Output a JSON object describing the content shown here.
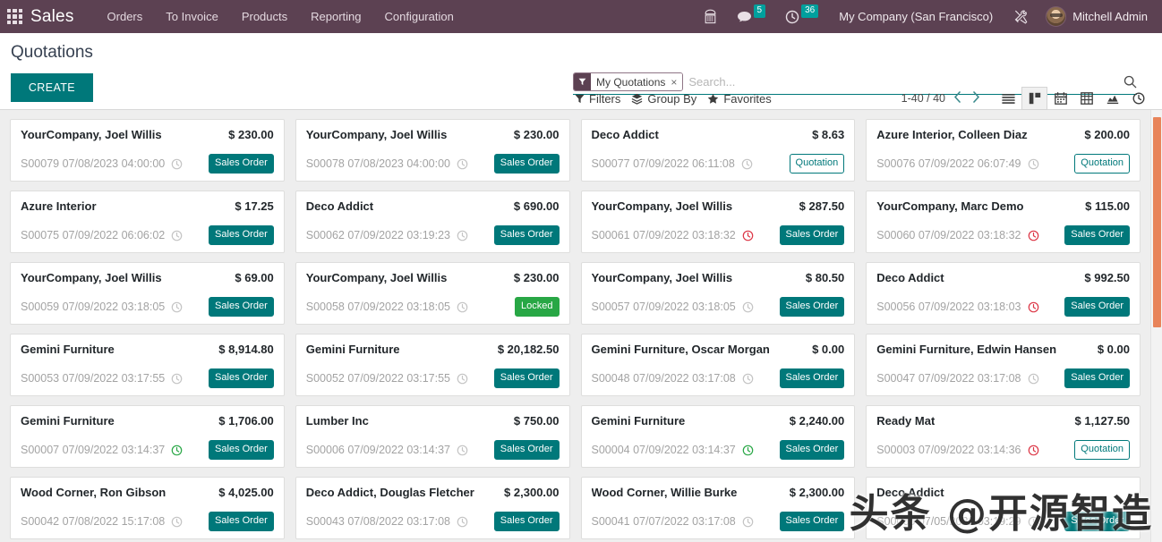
{
  "navbar": {
    "apps_icon": "apps-grid-icon",
    "brand": "Sales",
    "menu": [
      {
        "label": "Orders"
      },
      {
        "label": "To Invoice"
      },
      {
        "label": "Products"
      },
      {
        "label": "Reporting"
      },
      {
        "label": "Configuration"
      }
    ],
    "right": {
      "phone_icon": "dialpad-icon",
      "messages_icon": "chat-icon",
      "messages_count": "5",
      "activities_icon": "clock-icon",
      "activities_count": "36",
      "company": "My Company (San Francisco)",
      "tools_icon": "wrench-screwdriver-icon",
      "avatar_icon": "user-avatar",
      "user": "Mitchell Admin"
    }
  },
  "control_panel": {
    "title": "Quotations",
    "create_label": "CREATE",
    "search": {
      "facet_icon": "filter-funnel-icon",
      "facet_label": "My Quotations",
      "facet_remove": "×",
      "placeholder": "Search...",
      "value": "",
      "search_icon": "search-icon"
    },
    "filters_label": "Filters",
    "groupby_label": "Group By",
    "favorites_label": "Favorites",
    "pager": "1-40 / 40",
    "views": [
      {
        "name": "list",
        "active": false
      },
      {
        "name": "kanban",
        "active": true
      },
      {
        "name": "calendar",
        "active": false
      },
      {
        "name": "pivot",
        "active": false
      },
      {
        "name": "graph",
        "active": false
      },
      {
        "name": "activity",
        "active": false
      }
    ]
  },
  "kanban": {
    "cards": [
      {
        "customer": "YourCompany, Joel Willis",
        "amount": "$ 230.00",
        "ref": "S00079 07/08/2023 04:00:00",
        "activity": "none",
        "status": "Sales Order",
        "status_type": "sales-order"
      },
      {
        "customer": "YourCompany, Joel Willis",
        "amount": "$ 230.00",
        "ref": "S00078 07/08/2023 04:00:00",
        "activity": "none",
        "status": "Sales Order",
        "status_type": "sales-order"
      },
      {
        "customer": "Deco Addict",
        "amount": "$ 8.63",
        "ref": "S00077 07/09/2022 06:11:08",
        "activity": "none",
        "status": "Quotation",
        "status_type": "quotation"
      },
      {
        "customer": "Azure Interior, Colleen Diaz",
        "amount": "$ 200.00",
        "ref": "S00076 07/09/2022 06:07:49",
        "activity": "none",
        "status": "Quotation",
        "status_type": "quotation"
      },
      {
        "customer": "Azure Interior",
        "amount": "$ 17.25",
        "ref": "S00075 07/09/2022 06:06:02",
        "activity": "none",
        "status": "Sales Order",
        "status_type": "sales-order"
      },
      {
        "customer": "Deco Addict",
        "amount": "$ 690.00",
        "ref": "S00062 07/09/2022 03:19:23",
        "activity": "none",
        "status": "Sales Order",
        "status_type": "sales-order"
      },
      {
        "customer": "YourCompany, Joel Willis",
        "amount": "$ 287.50",
        "ref": "S00061 07/09/2022 03:18:32",
        "activity": "late",
        "status": "Sales Order",
        "status_type": "sales-order"
      },
      {
        "customer": "YourCompany, Marc Demo",
        "amount": "$ 115.00",
        "ref": "S00060 07/09/2022 03:18:32",
        "activity": "late",
        "status": "Sales Order",
        "status_type": "sales-order"
      },
      {
        "customer": "YourCompany, Joel Willis",
        "amount": "$ 69.00",
        "ref": "S00059 07/09/2022 03:18:05",
        "activity": "none",
        "status": "Sales Order",
        "status_type": "sales-order"
      },
      {
        "customer": "YourCompany, Joel Willis",
        "amount": "$ 230.00",
        "ref": "S00058 07/09/2022 03:18:05",
        "activity": "none",
        "status": "Locked",
        "status_type": "locked"
      },
      {
        "customer": "YourCompany, Joel Willis",
        "amount": "$ 80.50",
        "ref": "S00057 07/09/2022 03:18:05",
        "activity": "none",
        "status": "Sales Order",
        "status_type": "sales-order"
      },
      {
        "customer": "Deco Addict",
        "amount": "$ 992.50",
        "ref": "S00056 07/09/2022 03:18:03",
        "activity": "late",
        "status": "Sales Order",
        "status_type": "sales-order"
      },
      {
        "customer": "Gemini Furniture",
        "amount": "$ 8,914.80",
        "ref": "S00053 07/09/2022 03:17:55",
        "activity": "none",
        "status": "Sales Order",
        "status_type": "sales-order"
      },
      {
        "customer": "Gemini Furniture",
        "amount": "$ 20,182.50",
        "ref": "S00052 07/09/2022 03:17:55",
        "activity": "none",
        "status": "Sales Order",
        "status_type": "sales-order"
      },
      {
        "customer": "Gemini Furniture, Oscar Morgan",
        "amount": "$ 0.00",
        "ref": "S00048 07/09/2022 03:17:08",
        "activity": "none",
        "status": "Sales Order",
        "status_type": "sales-order"
      },
      {
        "customer": "Gemini Furniture, Edwin Hansen",
        "amount": "$ 0.00",
        "ref": "S00047 07/09/2022 03:17:08",
        "activity": "none",
        "status": "Sales Order",
        "status_type": "sales-order"
      },
      {
        "customer": "Gemini Furniture",
        "amount": "$ 1,706.00",
        "ref": "S00007 07/09/2022 03:14:37",
        "activity": "planned",
        "status": "Sales Order",
        "status_type": "sales-order"
      },
      {
        "customer": "Lumber Inc",
        "amount": "$ 750.00",
        "ref": "S00006 07/09/2022 03:14:37",
        "activity": "none",
        "status": "Sales Order",
        "status_type": "sales-order"
      },
      {
        "customer": "Gemini Furniture",
        "amount": "$ 2,240.00",
        "ref": "S00004 07/09/2022 03:14:37",
        "activity": "planned",
        "status": "Sales Order",
        "status_type": "sales-order"
      },
      {
        "customer": "Ready Mat",
        "amount": "$ 1,127.50",
        "ref": "S00003 07/09/2022 03:14:36",
        "activity": "late",
        "status": "Quotation",
        "status_type": "quotation"
      },
      {
        "customer": "Wood Corner, Ron Gibson",
        "amount": "$ 4,025.00",
        "ref": "S00042 07/08/2022 15:17:08",
        "activity": "none",
        "status": "Sales Order",
        "status_type": "sales-order"
      },
      {
        "customer": "Deco Addict, Douglas Fletcher",
        "amount": "$ 2,300.00",
        "ref": "S00043 07/08/2022 03:17:08",
        "activity": "none",
        "status": "Sales Order",
        "status_type": "sales-order"
      },
      {
        "customer": "Wood Corner, Willie Burke",
        "amount": "$ 2,300.00",
        "ref": "S00041 07/07/2022 03:17:08",
        "activity": "none",
        "status": "Sales Order",
        "status_type": "sales-order"
      },
      {
        "customer": "Deco Addict",
        "amount": "",
        "ref": "S00065 07/05/2022 03:19:29",
        "activity": "none",
        "status": "Sales Order",
        "status_type": "sales-order"
      }
    ]
  },
  "watermark": "头条 @开源智造",
  "colors": {
    "navbar_bg": "#5c4152",
    "accent": "#00787a",
    "badge_teal": "#00a09d",
    "locked_green": "#28a745",
    "late_red": "#dc3545",
    "planned_green": "#28a745",
    "scrollbar_thumb": "#e8845a",
    "board_bg": "#eeeeee"
  }
}
